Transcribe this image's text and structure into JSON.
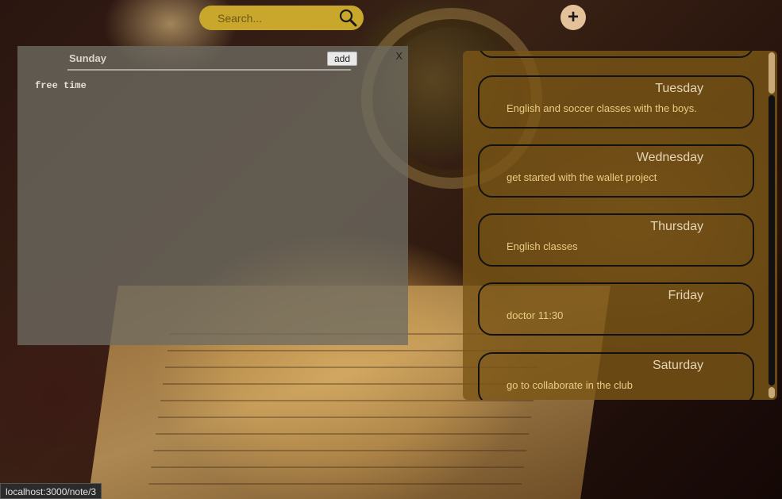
{
  "search": {
    "placeholder": "Search..."
  },
  "add_button": {
    "label": "+"
  },
  "editor": {
    "title": "Sunday",
    "add_label": "add",
    "close_label": "X",
    "body": "free time"
  },
  "notes": [
    {
      "day": "",
      "text": ""
    },
    {
      "day": "Tuesday",
      "text": "English and soccer classes with the boys."
    },
    {
      "day": "Wednesday",
      "text": "get started with the wallet project"
    },
    {
      "day": "Thursday",
      "text": "English classes"
    },
    {
      "day": "Friday",
      "text": "doctor 11:30"
    },
    {
      "day": "Saturday",
      "text": "go to collaborate in the club"
    },
    {
      "day": "",
      "text": ""
    }
  ],
  "status_bar": {
    "url": "localhost:3000/note/3"
  },
  "colors": {
    "search_bg": "#c9a62c",
    "add_circle": "#e3c29a",
    "notes_panel": "#7a5516",
    "editor_panel": "#6e6c62"
  }
}
